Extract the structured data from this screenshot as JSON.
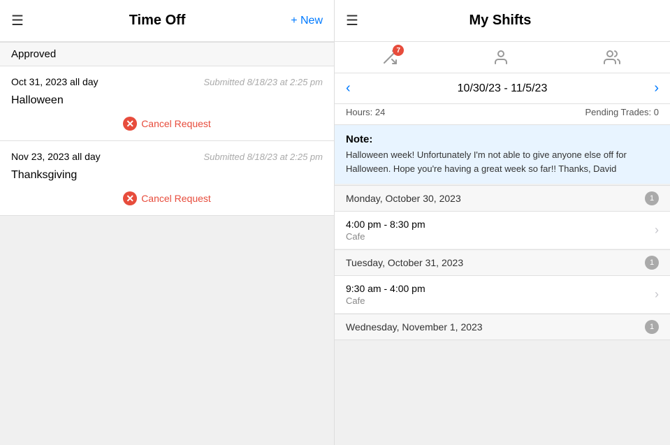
{
  "left": {
    "hamburger": "☰",
    "title": "Time Off",
    "new_button": "+ New",
    "section_label": "Approved",
    "requests": [
      {
        "date": "Oct 31, 2023 all day",
        "submitted": "Submitted 8/18/23 at 2:25 pm",
        "name": "Halloween",
        "cancel_label": "Cancel Request"
      },
      {
        "date": "Nov 23, 2023 all day",
        "submitted": "Submitted 8/18/23 at 2:25 pm",
        "name": "Thanksgiving",
        "cancel_label": "Cancel Request"
      }
    ]
  },
  "right": {
    "hamburger": "☰",
    "title": "My Shifts",
    "tabs": [
      {
        "icon": "shuffle",
        "badge": "7"
      },
      {
        "icon": "person",
        "badge": ""
      },
      {
        "icon": "group",
        "badge": ""
      }
    ],
    "date_range": "10/30/23 - 11/5/23",
    "nav_prev": "‹",
    "nav_next": "›",
    "hours_label": "Hours: 24",
    "pending_trades": "Pending Trades: 0",
    "note_label": "Note:",
    "note_text": "Halloween week! Unfortunately I'm not able to give anyone else off for Halloween. Hope you're having a great week so far!! Thanks, David",
    "days": [
      {
        "label": "Monday, October 30, 2023",
        "count": "1",
        "shifts": [
          {
            "time": "4:00 pm - 8:30 pm",
            "location": "Cafe"
          }
        ]
      },
      {
        "label": "Tuesday, October 31, 2023",
        "count": "1",
        "shifts": [
          {
            "time": "9:30 am - 4:00 pm",
            "location": "Cafe"
          }
        ]
      },
      {
        "label": "Wednesday, November 1, 2023",
        "count": "1",
        "shifts": []
      }
    ]
  }
}
